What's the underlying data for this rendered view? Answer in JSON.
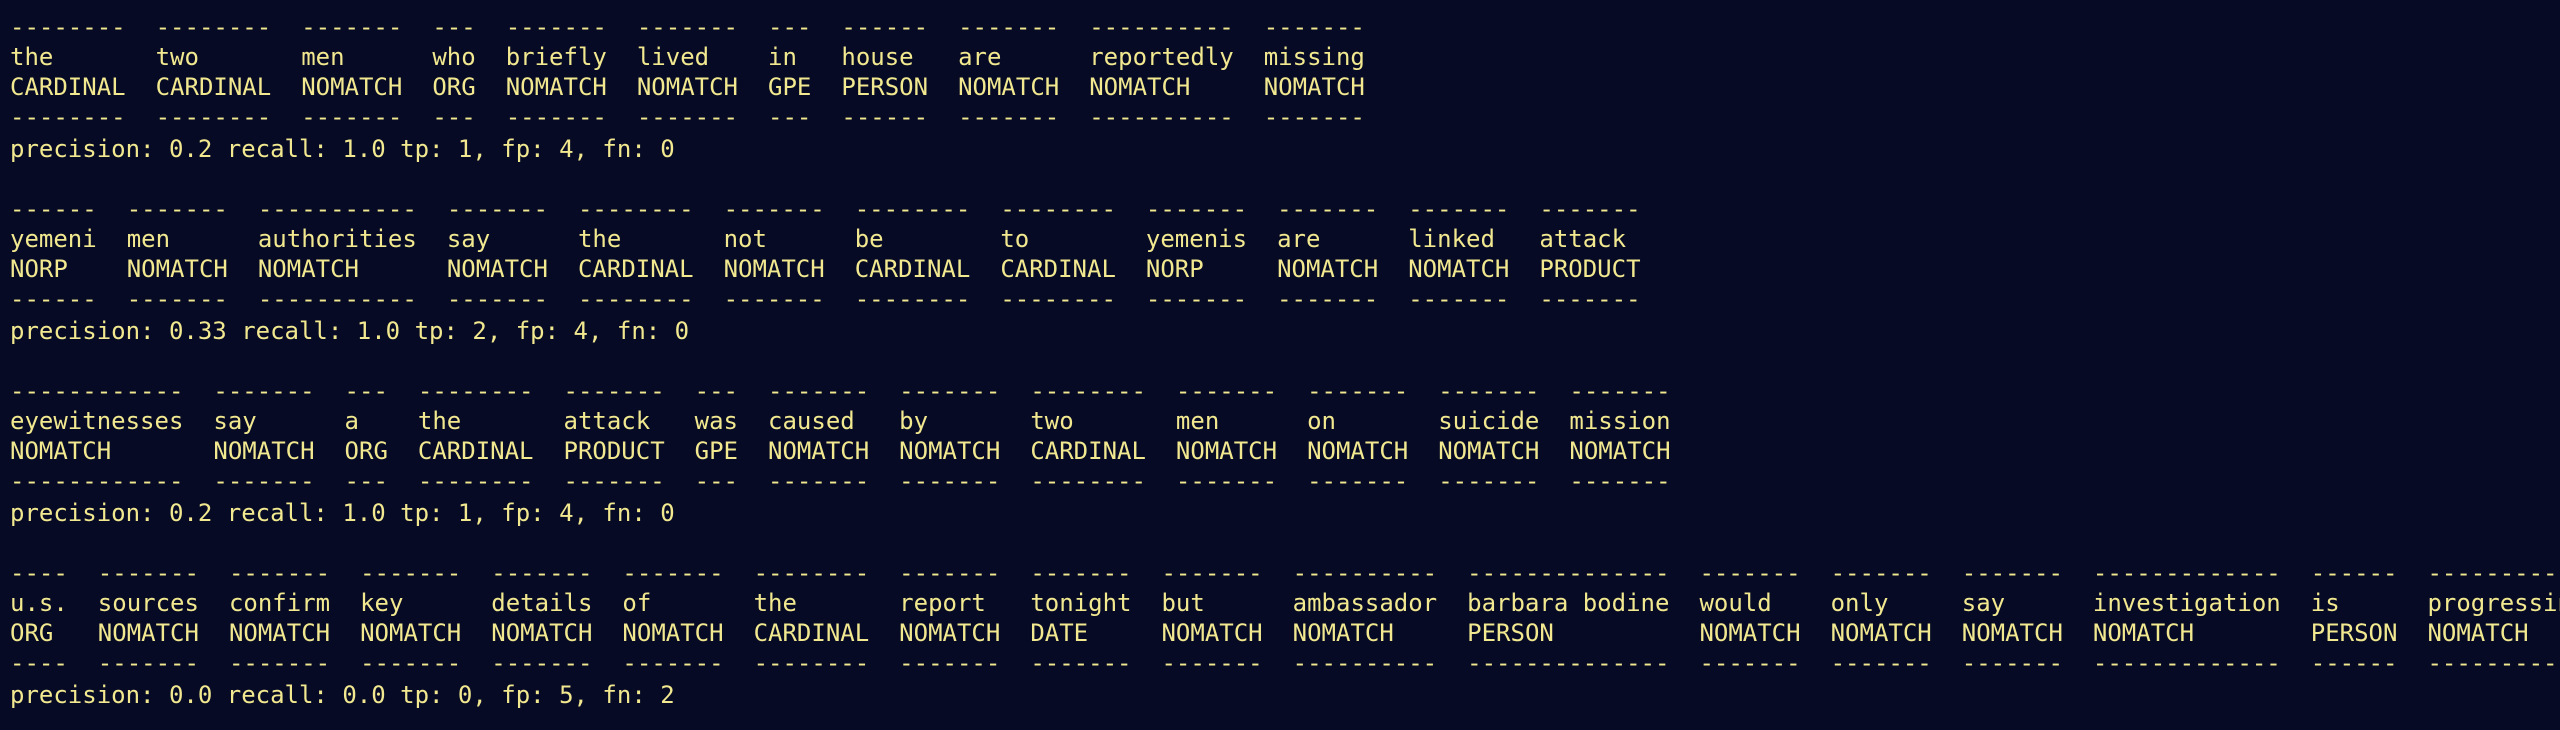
{
  "terminal": {
    "blocks": [
      {
        "columns": [
          {
            "word": "the",
            "label": "CARDINAL",
            "dashes": "--------"
          },
          {
            "word": "two",
            "label": "CARDINAL",
            "dashes": "--------"
          },
          {
            "word": "men",
            "label": "NOMATCH",
            "dashes": "-------"
          },
          {
            "word": "who",
            "label": "ORG",
            "dashes": "---"
          },
          {
            "word": "briefly",
            "label": "NOMATCH",
            "dashes": "-------"
          },
          {
            "word": "lived",
            "label": "NOMATCH",
            "dashes": "-------"
          },
          {
            "word": "in",
            "label": "GPE",
            "dashes": "---"
          },
          {
            "word": "house",
            "label": "PERSON",
            "dashes": "------"
          },
          {
            "word": "are",
            "label": "NOMATCH",
            "dashes": "-------"
          },
          {
            "word": "reportedly",
            "label": "NOMATCH",
            "dashes": "----------"
          },
          {
            "word": "missing",
            "label": "NOMATCH",
            "dashes": "-------"
          }
        ],
        "metrics": "precision: 0.2 recall: 1.0 tp: 1, fp: 4, fn: 0"
      },
      {
        "columns": [
          {
            "word": "yemeni",
            "label": "NORP",
            "dashes": "------"
          },
          {
            "word": "men",
            "label": "NOMATCH",
            "dashes": "-------"
          },
          {
            "word": "authorities",
            "label": "NOMATCH",
            "dashes": "-----------"
          },
          {
            "word": "say",
            "label": "NOMATCH",
            "dashes": "-------"
          },
          {
            "word": "the",
            "label": "CARDINAL",
            "dashes": "--------"
          },
          {
            "word": "not",
            "label": "NOMATCH",
            "dashes": "-------"
          },
          {
            "word": "be",
            "label": "CARDINAL",
            "dashes": "--------"
          },
          {
            "word": "to",
            "label": "CARDINAL",
            "dashes": "--------"
          },
          {
            "word": "yemenis",
            "label": "NORP",
            "dashes": "-------"
          },
          {
            "word": "are",
            "label": "NOMATCH",
            "dashes": "-------"
          },
          {
            "word": "linked",
            "label": "NOMATCH",
            "dashes": "-------"
          },
          {
            "word": "attack",
            "label": "PRODUCT",
            "dashes": "-------"
          }
        ],
        "metrics": "precision: 0.33 recall: 1.0 tp: 2, fp: 4, fn: 0"
      },
      {
        "columns": [
          {
            "word": "eyewitnesses",
            "label": "NOMATCH",
            "dashes": "------------"
          },
          {
            "word": "say",
            "label": "NOMATCH",
            "dashes": "-------"
          },
          {
            "word": "a",
            "label": "ORG",
            "dashes": "---"
          },
          {
            "word": "the",
            "label": "CARDINAL",
            "dashes": "--------"
          },
          {
            "word": "attack",
            "label": "PRODUCT",
            "dashes": "-------"
          },
          {
            "word": "was",
            "label": "GPE",
            "dashes": "---"
          },
          {
            "word": "caused",
            "label": "NOMATCH",
            "dashes": "-------"
          },
          {
            "word": "by",
            "label": "NOMATCH",
            "dashes": "-------"
          },
          {
            "word": "two",
            "label": "CARDINAL",
            "dashes": "--------"
          },
          {
            "word": "men",
            "label": "NOMATCH",
            "dashes": "-------"
          },
          {
            "word": "on",
            "label": "NOMATCH",
            "dashes": "-------"
          },
          {
            "word": "suicide",
            "label": "NOMATCH",
            "dashes": "-------"
          },
          {
            "word": "mission",
            "label": "NOMATCH",
            "dashes": "-------"
          }
        ],
        "metrics": "precision: 0.2 recall: 1.0 tp: 1, fp: 4, fn: 0"
      },
      {
        "columns": [
          {
            "word": "u.s.",
            "label": "ORG",
            "dashes": "----"
          },
          {
            "word": "sources",
            "label": "NOMATCH",
            "dashes": "-------"
          },
          {
            "word": "confirm",
            "label": "NOMATCH",
            "dashes": "-------"
          },
          {
            "word": "key",
            "label": "NOMATCH",
            "dashes": "-------"
          },
          {
            "word": "details",
            "label": "NOMATCH",
            "dashes": "-------"
          },
          {
            "word": "of",
            "label": "NOMATCH",
            "dashes": "-------"
          },
          {
            "word": "the",
            "label": "CARDINAL",
            "dashes": "--------"
          },
          {
            "word": "report",
            "label": "NOMATCH",
            "dashes": "-------"
          },
          {
            "word": "tonight",
            "label": "DATE",
            "dashes": "-------"
          },
          {
            "word": "but",
            "label": "NOMATCH",
            "dashes": "-------"
          },
          {
            "word": "ambassador",
            "label": "NOMATCH",
            "dashes": "----------"
          },
          {
            "word": "barbara bodine",
            "label": "PERSON",
            "dashes": "--------------"
          },
          {
            "word": "would",
            "label": "NOMATCH",
            "dashes": "-------"
          },
          {
            "word": "only",
            "label": "NOMATCH",
            "dashes": "-------"
          },
          {
            "word": "say",
            "label": "NOMATCH",
            "dashes": "-------"
          },
          {
            "word": "investigation",
            "label": "NOMATCH",
            "dashes": "-------------"
          },
          {
            "word": "is",
            "label": "PERSON",
            "dashes": "------"
          },
          {
            "word": "progressing",
            "label": "NOMATCH",
            "dashes": "-----------"
          }
        ],
        "metrics": "precision: 0.0 recall: 0.0 tp: 0, fp: 5, fn: 2"
      }
    ]
  }
}
